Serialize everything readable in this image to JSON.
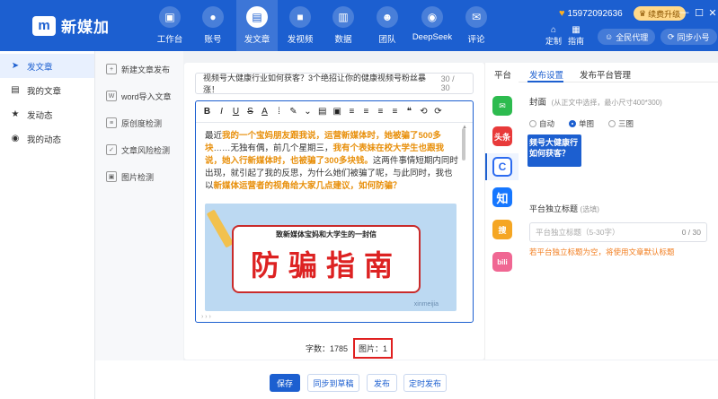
{
  "app": {
    "name": "新媒加",
    "logo_mark": "m"
  },
  "topnav": [
    {
      "label": "工作台",
      "icon": "▣"
    },
    {
      "label": "账号",
      "icon": "●"
    },
    {
      "label": "发文章",
      "icon": "▤"
    },
    {
      "label": "发视频",
      "icon": "■"
    },
    {
      "label": "数据",
      "icon": "▥"
    },
    {
      "label": "团队",
      "icon": "☻"
    },
    {
      "label": "DeepSeek",
      "icon": "◉"
    },
    {
      "label": "评论",
      "icon": "✉"
    }
  ],
  "user": {
    "phone": "15972092636",
    "upgrade_label": "续费升级"
  },
  "tools": [
    {
      "label": "定制",
      "icon": "⌂"
    },
    {
      "label": "指南",
      "icon": "▦"
    }
  ],
  "pills": {
    "agent": "全民代理",
    "sync": "同步小号"
  },
  "sidebar": [
    {
      "label": "发文章",
      "icon": "➤"
    },
    {
      "label": "我的文章",
      "icon": "▤"
    },
    {
      "label": "发动态",
      "icon": "★"
    },
    {
      "label": "我的动态",
      "icon": "◉"
    }
  ],
  "submenu": [
    {
      "label": "新建文章发布",
      "icon": "+"
    },
    {
      "label": "word导入文章",
      "icon": "W"
    },
    {
      "label": "原创度检测",
      "icon": "≡"
    },
    {
      "label": "文章风险检测",
      "icon": "✓"
    },
    {
      "label": "图片检测",
      "icon": "▣"
    }
  ],
  "article": {
    "title": "视频号大健康行业如何获客？3个绝招让你的健康视频号粉丝暴涨！",
    "title_count": "30 / 30",
    "p1": "最近",
    "h1": "我的一个宝妈朋友跟我说，运营新媒体时，她被骗了500多块",
    "p2": "……无独有偶，前几个星期三，",
    "h2": "我有个表妹在校大学生也跟我说，她入行新媒体时，也被骗了300多块钱。",
    "p3": "这两件事情短期内同时出现，就引起了我的反思，为什么她们被骗了呢，与此同时，我也以",
    "h3": "新媒体运营者的视角给大家几点建议，如何防骗？",
    "banner_sub": "致新媒体宝妈和大学生的一封信",
    "banner_main": "防骗指南",
    "watermark": "xinmeijia"
  },
  "toolbar": [
    "B",
    "I",
    "U",
    "S",
    "A",
    "⁞",
    "✎",
    "⌄",
    "▤",
    "▣",
    "≡",
    "≡",
    "≡",
    "≡",
    "❝",
    "⟲",
    "⟳"
  ],
  "stats": {
    "words_label": "字数：1785",
    "images_label": "图片：1"
  },
  "platforms": {
    "title": "平台",
    "items": [
      {
        "name": "wechat-icon",
        "glyph": "✉",
        "color": "#2dbb4f"
      },
      {
        "name": "toutiao-icon",
        "glyph": "头条",
        "color": "#e83a3a"
      },
      {
        "name": "baijia-icon",
        "glyph": "C",
        "color": "#2c6bf0"
      },
      {
        "name": "zhihu-icon",
        "glyph": "知",
        "color": "#1677ff"
      },
      {
        "name": "sohu-icon",
        "glyph": "搜",
        "color": "#f5a623"
      },
      {
        "name": "bilibili-icon",
        "glyph": "bili",
        "color": "#f06793"
      }
    ]
  },
  "panel": {
    "tab_settings": "发布设置",
    "tab_manage": "发布平台管理",
    "cover_label": "封面",
    "cover_hint": "(从正文中选择，最小尺寸400*300)",
    "radio_auto": "自动",
    "radio_single": "单图",
    "radio_triple": "三图",
    "cover_text": "频号大健康行 如何获客？",
    "ind_title": "平台独立标题",
    "ind_title_sub": "(选填)",
    "ind_placeholder": "平台独立标题（5-30字）",
    "ind_count": "0 / 30",
    "ind_tip": "若平台独立标题为空，将使用文章默认标题"
  },
  "buttons": {
    "save": "保存",
    "sync_draft": "同步到草稿",
    "publish": "发布",
    "schedule": "定时发布"
  }
}
